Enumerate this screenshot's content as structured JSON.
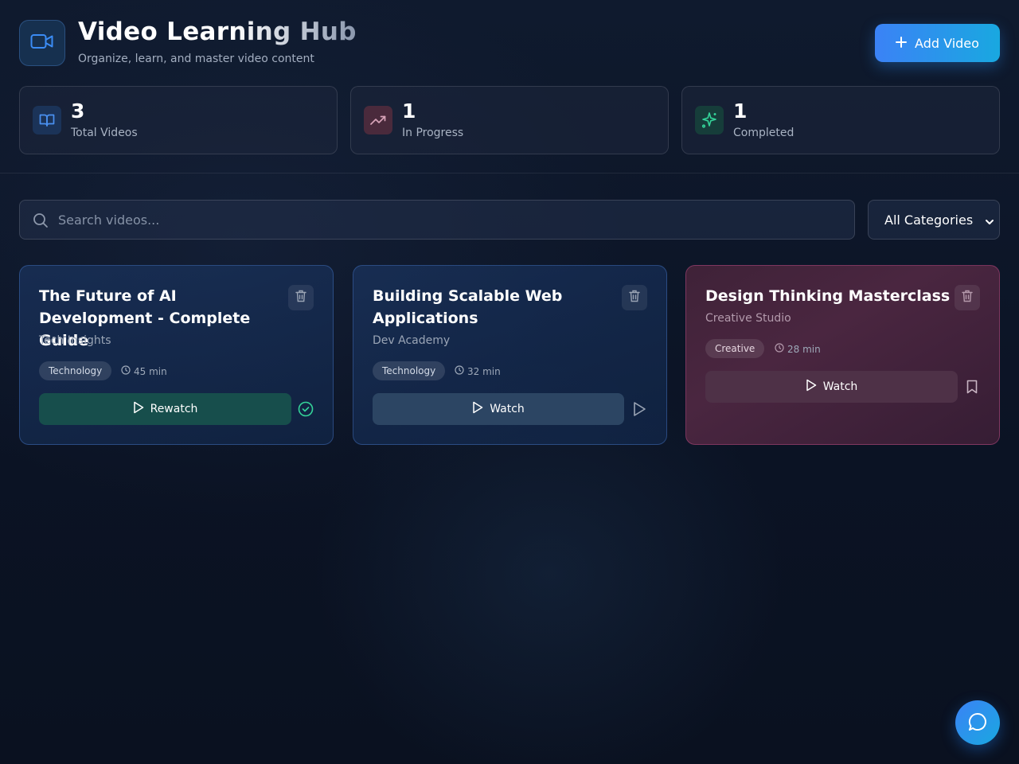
{
  "header": {
    "title": "Video Learning Hub",
    "subtitle": "Organize, learn, and master video content",
    "logo_icon": "video-camera-icon",
    "add_button_label": "Add Video"
  },
  "stats": [
    {
      "value": "3",
      "label": "Total Videos",
      "icon": "book-open-icon",
      "color": "#3b82f6"
    },
    {
      "value": "1",
      "label": "In Progress",
      "icon": "trending-up-icon",
      "color": "#d07a9a"
    },
    {
      "value": "1",
      "label": "Completed",
      "icon": "sparkles-icon",
      "color": "#34d399"
    }
  ],
  "toolbar": {
    "search_placeholder": "Search videos...",
    "search_value": "",
    "category_selected": "All Categories"
  },
  "videos": [
    {
      "title": "The Future of AI Development - Complete Guide",
      "channel": "Tech Insights",
      "category": "Technology",
      "duration": "45 min",
      "action_label": "Rewatch",
      "status": "completed",
      "status_icon": "check-circle-icon"
    },
    {
      "title": "Building Scalable Web Applications",
      "channel": "Dev Academy",
      "category": "Technology",
      "duration": "32 min",
      "action_label": "Watch",
      "status": "in-progress",
      "status_icon": "play-icon"
    },
    {
      "title": "Design Thinking Masterclass",
      "channel": "Creative Studio",
      "category": "Creative",
      "duration": "28 min",
      "action_label": "Watch",
      "status": "saved",
      "status_icon": "bookmark-icon"
    }
  ],
  "colors": {
    "accent": "#3b82f6",
    "accent_secondary": "#19a8e0",
    "completed_green": "#34d399",
    "creative_pink": "#c8508c"
  },
  "chat_icon": "message-circle-icon"
}
